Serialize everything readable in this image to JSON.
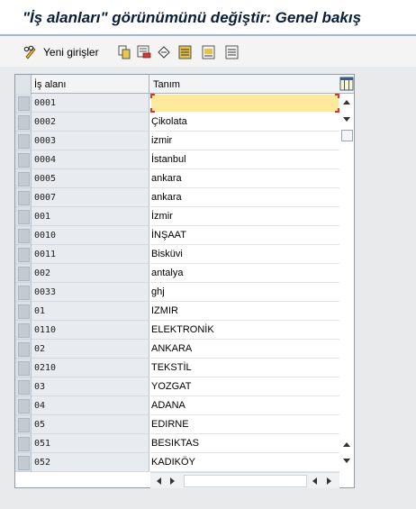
{
  "window": {
    "title": "\"İş alanları\" görünümünü değiştir: Genel bakış"
  },
  "toolbar": {
    "new_entries_label": "Yeni girişler",
    "icons": [
      "pencil-glasses-icon",
      "copy-icon",
      "delete-icon",
      "undo-icon",
      "select-all-icon",
      "select-block-icon",
      "deselect-all-icon"
    ]
  },
  "table": {
    "columns": [
      "İş alanı",
      "Tanım"
    ],
    "rows": [
      {
        "code": "0001",
        "desc": ""
      },
      {
        "code": "0002",
        "desc": "Çikolata"
      },
      {
        "code": "0003",
        "desc": "izmir"
      },
      {
        "code": "0004",
        "desc": "İstanbul"
      },
      {
        "code": "0005",
        "desc": "ankara"
      },
      {
        "code": "0007",
        "desc": "ankara"
      },
      {
        "code": "001",
        "desc": "İzmir"
      },
      {
        "code": "0010",
        "desc": "İNŞAAT"
      },
      {
        "code": "0011",
        "desc": "Bisküvi"
      },
      {
        "code": "002",
        "desc": "antalya"
      },
      {
        "code": "0033",
        "desc": "ghj"
      },
      {
        "code": "01",
        "desc": "IZMIR"
      },
      {
        "code": "0110",
        "desc": "ELEKTRONİK"
      },
      {
        "code": "02",
        "desc": "ANKARA"
      },
      {
        "code": "0210",
        "desc": "TEKSTİL"
      },
      {
        "code": "03",
        "desc": "YOZGAT"
      },
      {
        "code": "04",
        "desc": "ADANA"
      },
      {
        "code": "05",
        "desc": "EDIRNE"
      },
      {
        "code": "051",
        "desc": "BESIKTAS"
      },
      {
        "code": "052",
        "desc": "KADIKÖY"
      }
    ]
  },
  "colors": {
    "focus_cell": "#ffe99c",
    "key_column": "#e8ecf0",
    "title": "#0a1e3a"
  }
}
